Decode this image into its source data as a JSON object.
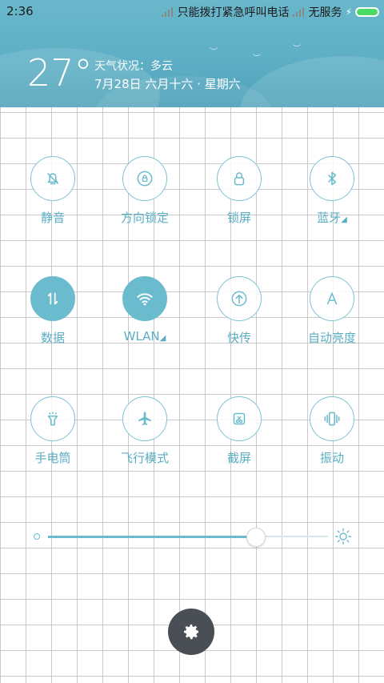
{
  "status_bar": {
    "time": "2:36",
    "carrier1": "只能拨打紧急呼叫电话",
    "carrier2": "无服务",
    "battery_color": "#4cd964"
  },
  "weather": {
    "temperature": "27°",
    "condition": "天气状况：多云",
    "date": "7月28日 六月十六 · 星期六"
  },
  "toggles": [
    {
      "label": "静音",
      "icon": "bell-muted-icon",
      "on": false
    },
    {
      "label": "方向锁定",
      "icon": "rotation-lock-icon",
      "on": false
    },
    {
      "label": "锁屏",
      "icon": "lock-icon",
      "on": false
    },
    {
      "label": "蓝牙",
      "icon": "bluetooth-icon",
      "on": false,
      "has_more": true
    },
    {
      "label": "数据",
      "icon": "mobile-data-icon",
      "on": true
    },
    {
      "label": "WLAN",
      "icon": "wifi-icon",
      "on": true,
      "has_more": true
    },
    {
      "label": "快传",
      "icon": "quick-transfer-icon",
      "on": false
    },
    {
      "label": "自动亮度",
      "icon": "auto-brightness-icon",
      "on": false
    },
    {
      "label": "手电筒",
      "icon": "flashlight-icon",
      "on": false
    },
    {
      "label": "飞行模式",
      "icon": "airplane-icon",
      "on": false
    },
    {
      "label": "截屏",
      "icon": "screenshot-icon",
      "on": false
    },
    {
      "label": "振动",
      "icon": "vibrate-icon",
      "on": false
    }
  ],
  "brightness": {
    "level": 0.74,
    "accent": "#6bbbce"
  },
  "settings": {
    "icon": "gear-icon"
  }
}
